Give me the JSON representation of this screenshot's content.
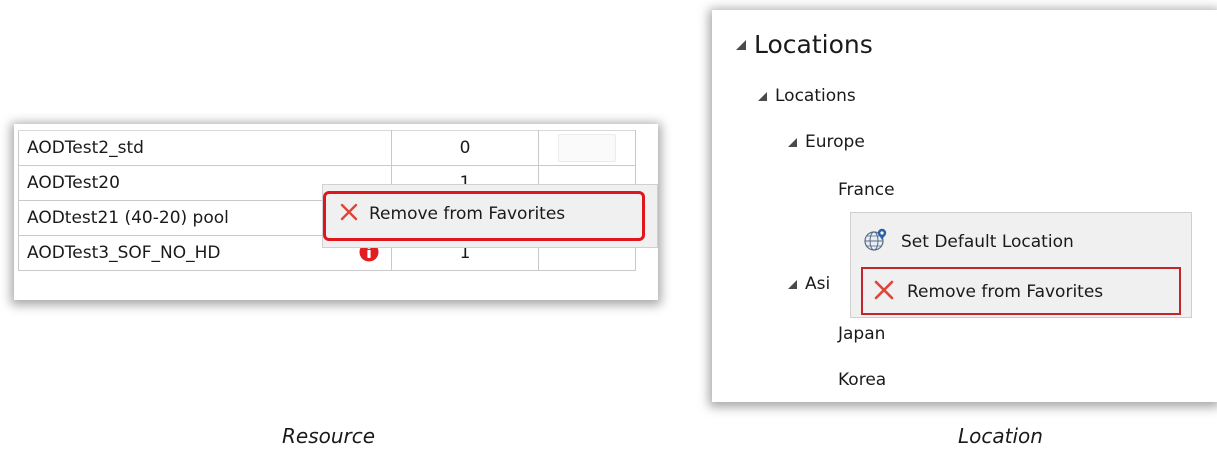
{
  "resource": {
    "rows": [
      {
        "name": "AODTest2_std",
        "value": "0"
      },
      {
        "name": "AODTest20",
        "value": "1"
      },
      {
        "name": "AODtest21 (40-20) pool",
        "value": ""
      },
      {
        "name": "AODTest3_SOF_NO_HD",
        "value": "1"
      }
    ],
    "context_menu": {
      "remove_label": "Remove from Favorites"
    },
    "caption": "Resource"
  },
  "location": {
    "root": "Locations",
    "tree": {
      "locations": "Locations",
      "europe": "Europe",
      "france": "France",
      "asia": "Asi",
      "japan": "Japan",
      "korea": "Korea"
    },
    "context_menu": {
      "set_default_label": "Set Default Location",
      "remove_label": "Remove from Favorites"
    },
    "caption": "Location"
  },
  "colors": {
    "highlight": "#e1161c",
    "x_icon": "#e0453a",
    "info_icon": "#e01f20",
    "globe": "#2f5fa6"
  },
  "icons": [
    "info-icon",
    "close-x-icon",
    "globe-pin-icon",
    "expand-triangle-icon"
  ]
}
